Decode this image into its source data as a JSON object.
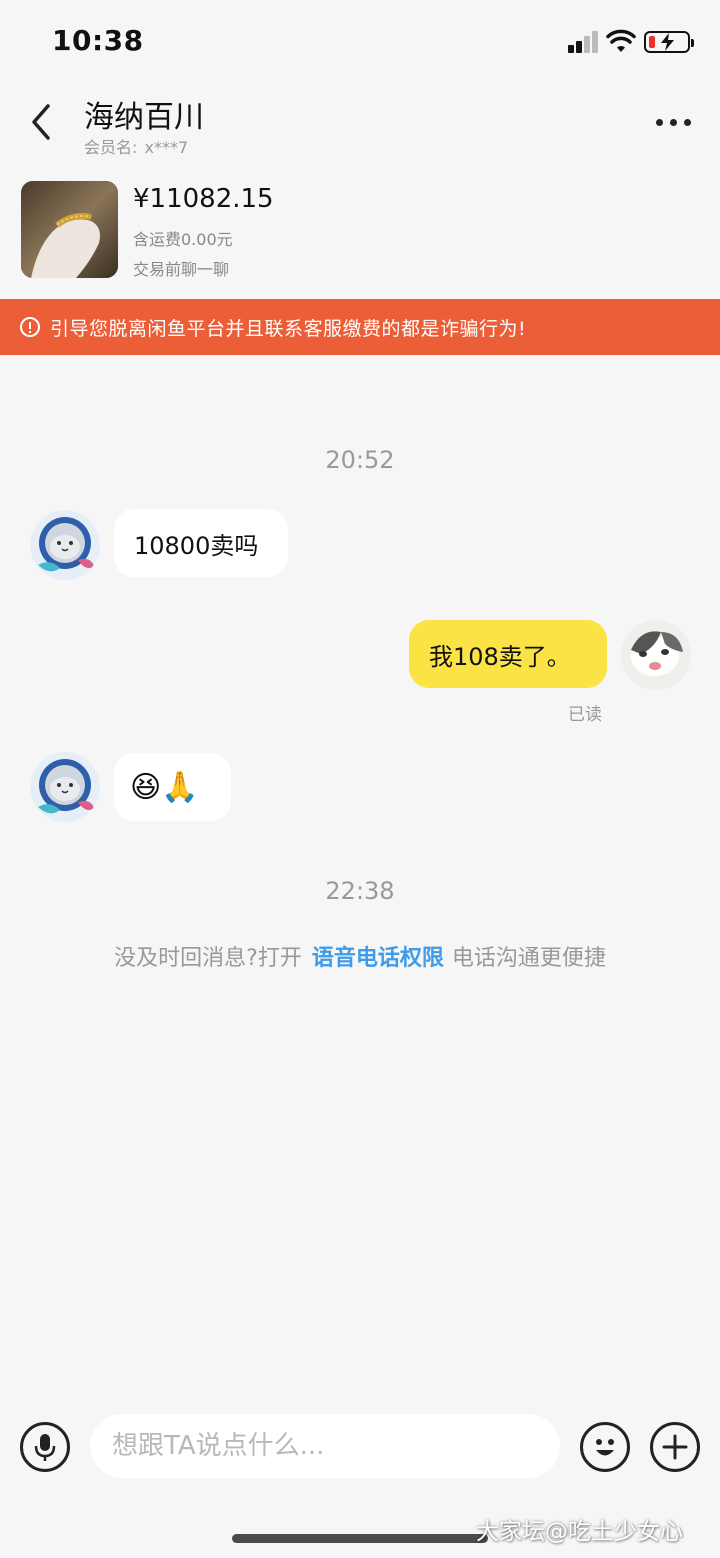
{
  "status_bar": {
    "time": "10:38",
    "battery_color": "#e9322d"
  },
  "header": {
    "title": "海纳百川",
    "member_label": "会员名:",
    "member_id": "x***7",
    "back_icon": "chevron-left-icon",
    "more_icon": "more-dots-icon"
  },
  "product": {
    "price": "¥11082.15",
    "shipping": "含运费0.00元",
    "note": "交易前聊一聊"
  },
  "warning": {
    "text": "引导您脱离闲鱼平台并且联系客服缴费的都是诈骗行为!",
    "background": "#ec5e37"
  },
  "chat": {
    "timestamp_1": "20:52",
    "messages": [
      {
        "side": "left",
        "text": "10800卖吗"
      },
      {
        "side": "right",
        "text": "我108卖了。",
        "status": "已读"
      },
      {
        "side": "left",
        "text": "😆🙏"
      }
    ],
    "timestamp_2": "22:38",
    "hint": {
      "prefix": "没及时回消息?打开",
      "link": "语音电话权限",
      "suffix": "电话沟通更便捷"
    }
  },
  "input_bar": {
    "placeholder": "想跟TA说点什么...",
    "mic_icon": "microphone-icon",
    "emoji_icon": "smiley-icon",
    "plus_icon": "plus-circle-icon"
  },
  "watermark": "大家坛@吃土少女心",
  "colors": {
    "accent_yellow": "#fbe345",
    "link_blue": "#3d9be9",
    "background": "#f6f6f6"
  }
}
